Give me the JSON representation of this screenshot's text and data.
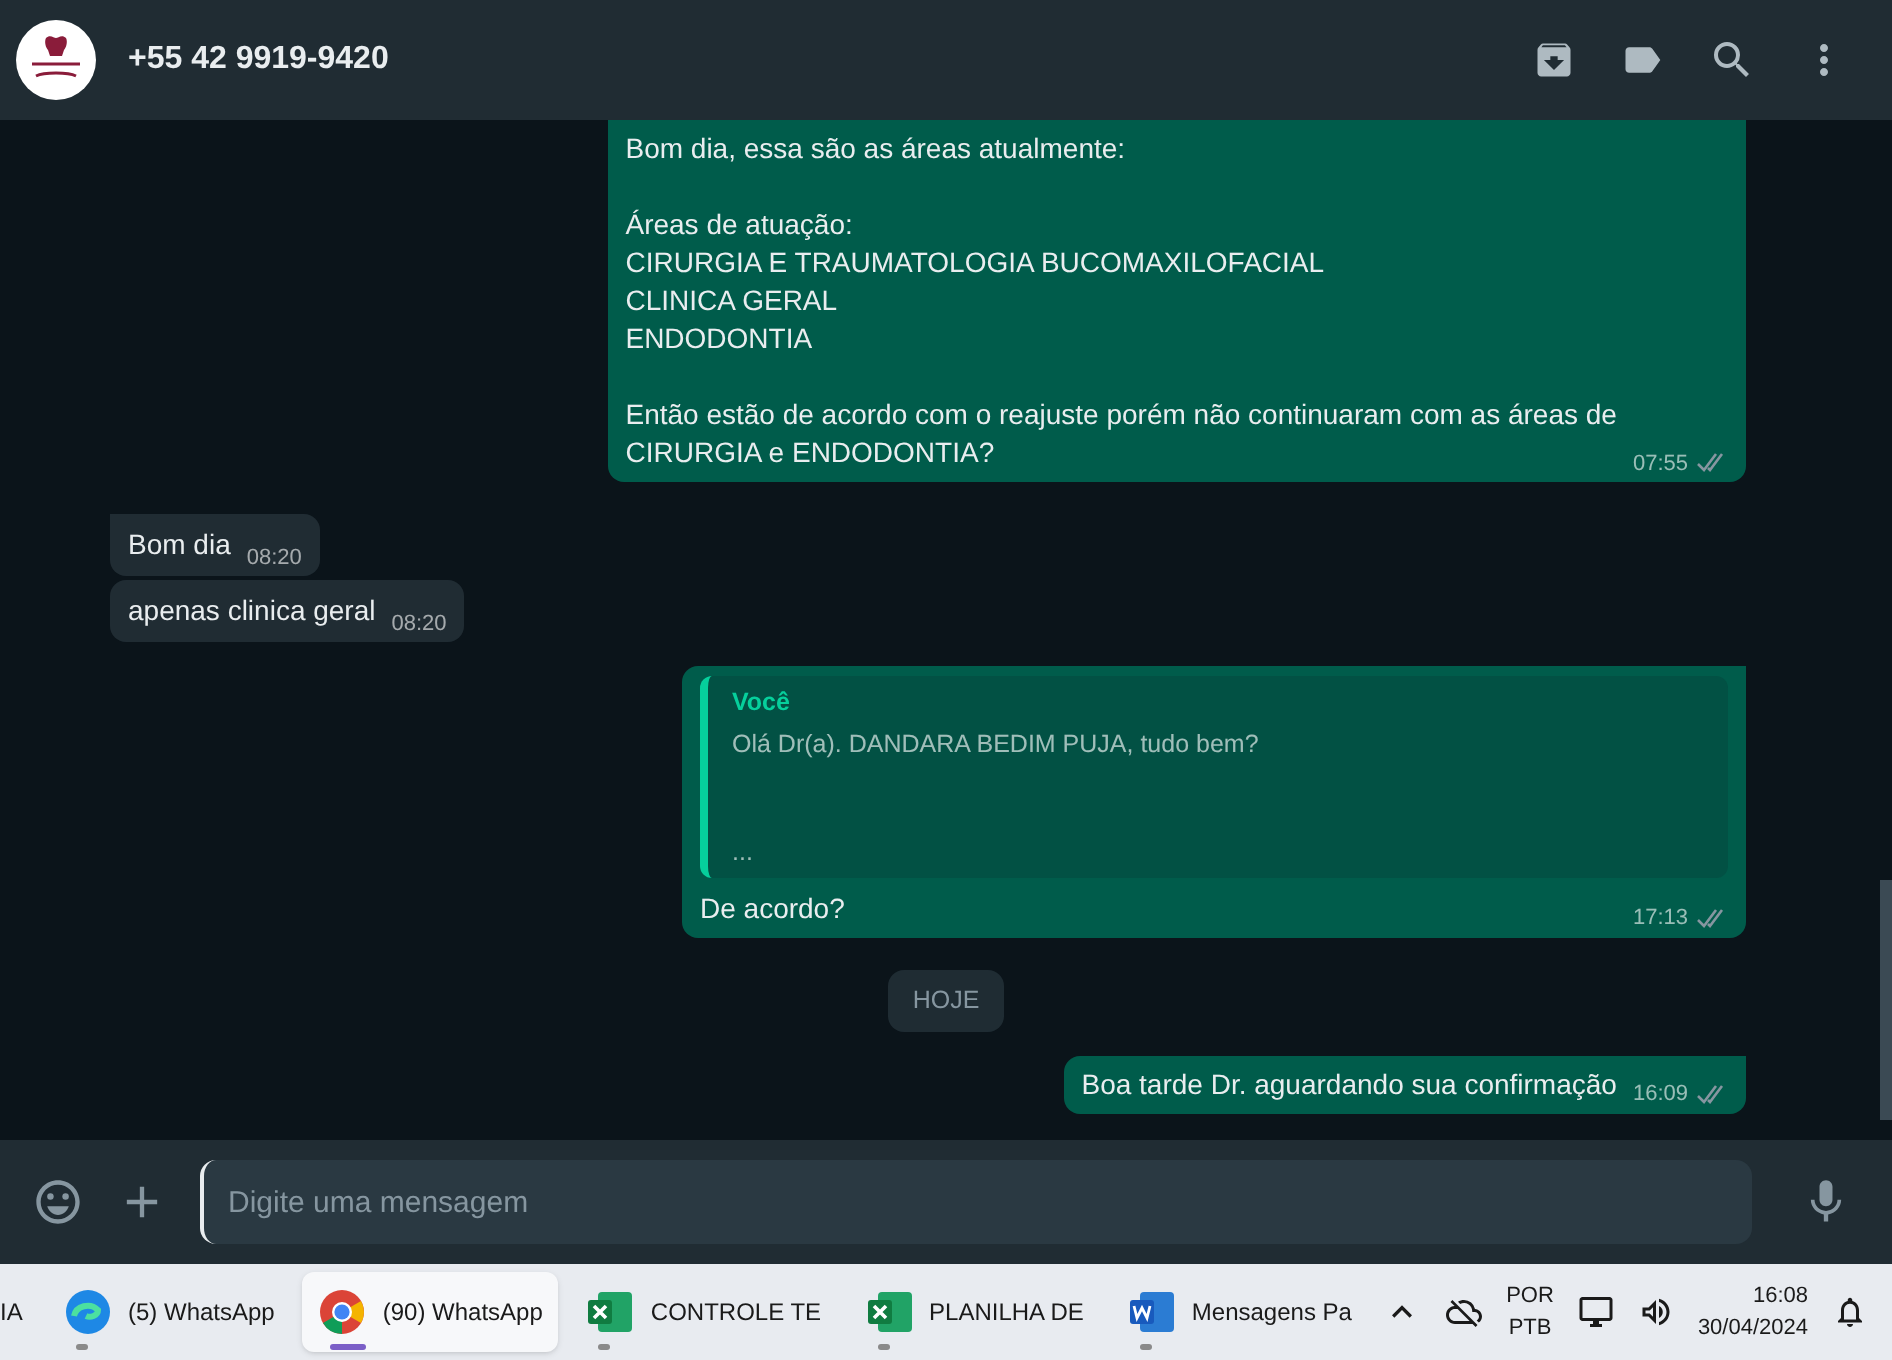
{
  "header": {
    "title": "+55 42 9919-9420"
  },
  "messages": [
    {
      "kind": "outgoing",
      "text": "Bom dia, essa são as áreas atualmente:\n\nÁreas de atuação:\nCIRURGIA E TRAUMATOLOGIA BUCOMAXILOFACIAL\nCLINICA GERAL\nENDODONTIA\n\nEntão estão de acordo com o reajuste porém não continuaram com as áreas de\nCIRURGIA e ENDODONTIA?",
      "time": "07:55",
      "read": false
    },
    {
      "kind": "incoming",
      "text": "Bom dia",
      "time": "08:20",
      "tail": true
    },
    {
      "kind": "incoming",
      "text": "apenas clinica geral",
      "time": "08:20"
    },
    {
      "kind": "outgoing",
      "quote_author": "Você",
      "quote_text": "Olá Dr(a). DANDARA BEDIM PUJA, tudo bem?\n\n\n...",
      "text": "De acordo?",
      "time": "17:13",
      "read": false,
      "tail": true
    },
    {
      "kind": "date",
      "text": "HOJE"
    },
    {
      "kind": "outgoing",
      "text": "Boa tarde Dr. aguardando sua confirmação",
      "time": "16:09",
      "read": false,
      "tail": true
    }
  ],
  "composer": {
    "placeholder": "Digite uma mensagem"
  },
  "taskbar": {
    "edge_text": "IA",
    "apps": [
      {
        "kind": "edge",
        "label": "(5) WhatsApp",
        "selected": false
      },
      {
        "kind": "chrome",
        "label": "(90) WhatsApp",
        "selected": true
      },
      {
        "kind": "excel",
        "label": "CONTROLE TE",
        "selected": false
      },
      {
        "kind": "excel",
        "label": "PLANILHA DE",
        "selected": false
      },
      {
        "kind": "word",
        "label": "Mensagens Pa",
        "selected": false
      }
    ],
    "language": "POR",
    "layout": "PTB",
    "time": "16:08",
    "date": "30/04/2024"
  }
}
